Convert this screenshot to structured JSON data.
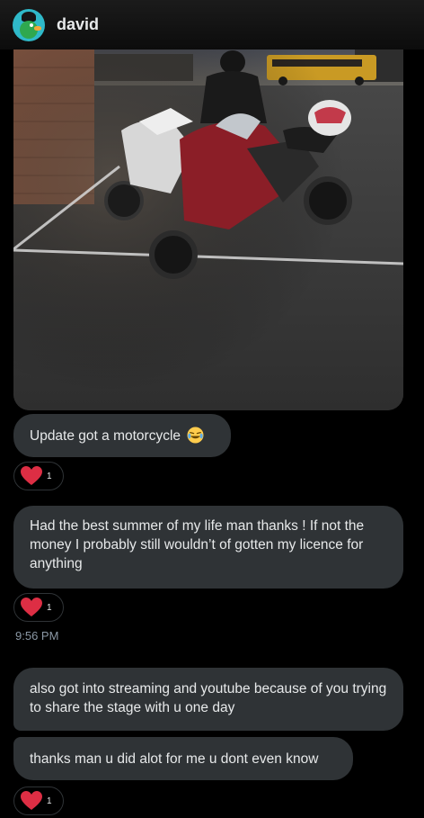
{
  "header": {
    "name": "david",
    "avatar_icon": "duck-avatar-icon"
  },
  "photo": {
    "description_icon": "motorcycle-photo"
  },
  "messages": [
    {
      "text": "Update got a motorcycle",
      "emoji": "😂",
      "reaction": {
        "icon": "heart-icon",
        "count": "1"
      }
    },
    {
      "text": "Had the best summer of my life man thanks ! If not the money I probably still wouldn’t of gotten my licence for anything",
      "reaction": {
        "icon": "heart-icon",
        "count": "1"
      }
    },
    {
      "text": "also got into streaming and youtube because of you trying to share the stage with u one day"
    },
    {
      "text": "thanks man u did alot for me u dont even know",
      "reaction": {
        "icon": "heart-icon",
        "count": "1"
      }
    }
  ],
  "timestamp": "9:56 PM",
  "colors": {
    "bubble": "#2f3336",
    "heart": "#f91880",
    "background": "#000000",
    "timestamp": "#8b98a5"
  }
}
